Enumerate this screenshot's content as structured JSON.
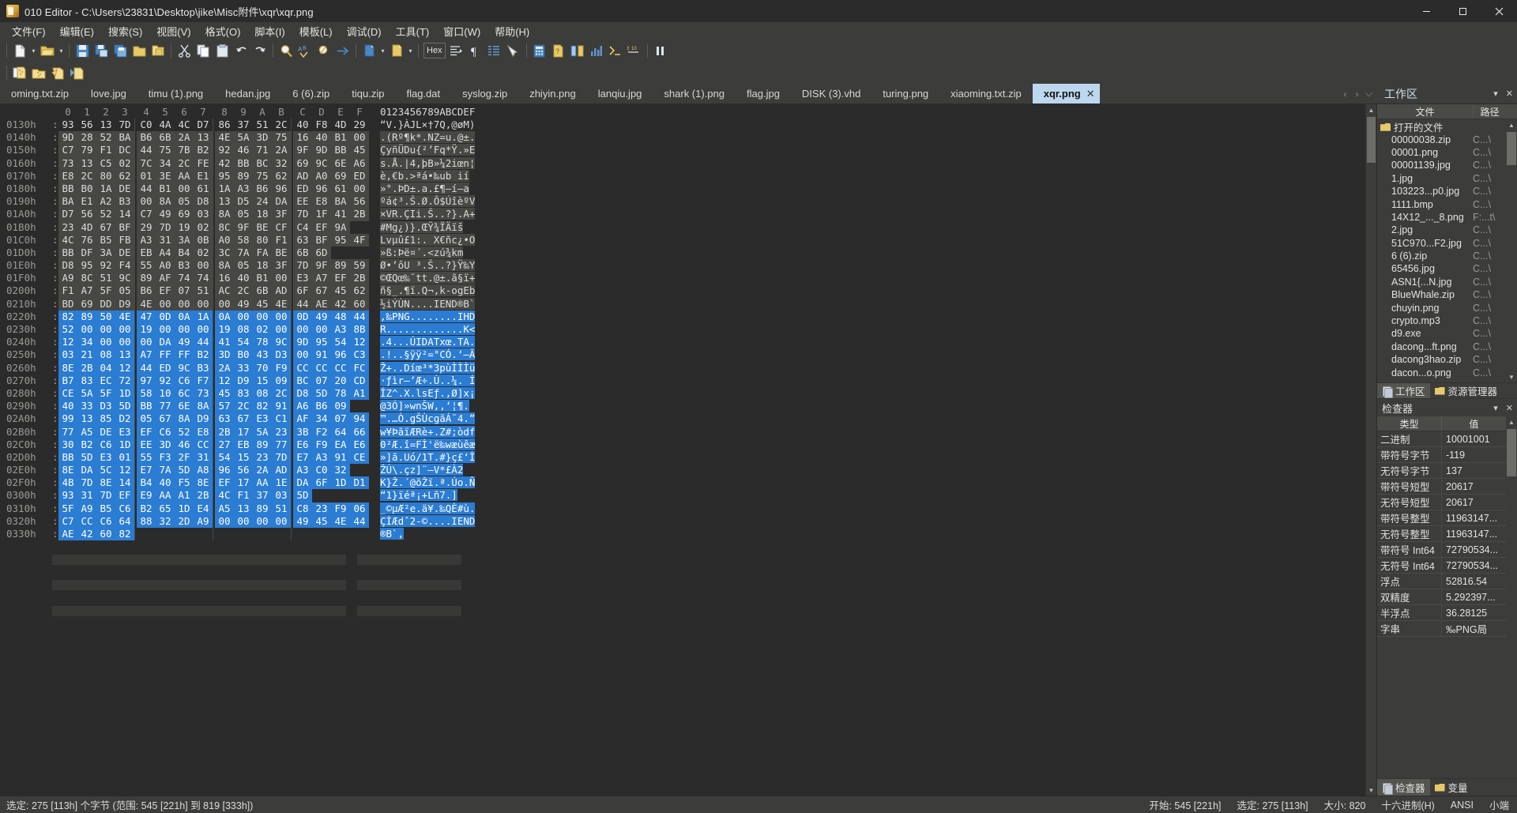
{
  "window": {
    "title": "010 Editor - C:\\Users\\23831\\Desktop\\jike\\Misc附件\\xqr\\xqr.png",
    "app_icon": "010-editor-icon",
    "minimize": "─",
    "maximize": "❐",
    "close": "✕"
  },
  "menu": [
    {
      "label": "文件(F)",
      "name": "menu-file"
    },
    {
      "label": "编辑(E)",
      "name": "menu-edit"
    },
    {
      "label": "搜索(S)",
      "name": "menu-search"
    },
    {
      "label": "视图(V)",
      "name": "menu-view"
    },
    {
      "label": "格式(O)",
      "name": "menu-format"
    },
    {
      "label": "脚本(I)",
      "name": "menu-script"
    },
    {
      "label": "模板(L)",
      "name": "menu-template"
    },
    {
      "label": "调试(D)",
      "name": "menu-debug"
    },
    {
      "label": "工具(T)",
      "name": "menu-tools"
    },
    {
      "label": "窗口(W)",
      "name": "menu-window"
    },
    {
      "label": "帮助(H)",
      "name": "menu-help"
    }
  ],
  "toolbar": {
    "hex_label": "Hex",
    "icons": [
      "new-file-icon",
      "open-folder-icon",
      "save-icon",
      "save-as-icon",
      "save-all-icon",
      "open-file-icon",
      "import-icon",
      "cut-icon",
      "copy-icon",
      "paste-icon",
      "undo-icon",
      "redo-icon",
      "find-icon",
      "replace-icon",
      "find-next-icon",
      "goto-icon",
      "import-hex-icon",
      "export-hex-icon",
      "hex-mode-icon",
      "line-format-icon",
      "paragraph-icon",
      "column-mode-icon",
      "highlight-icon",
      "calculator-icon",
      "checksum-icon",
      "compare-icon",
      "histogram-icon",
      "script-run-icon",
      "template-run-icon",
      "pause-icon"
    ],
    "row2_icons": [
      "new-script-icon",
      "open-script-icon",
      "run-script-icon",
      "run-template-icon"
    ]
  },
  "tabs": {
    "items": [
      {
        "label": "oming.txt.zip",
        "active": false
      },
      {
        "label": "love.jpg",
        "active": false
      },
      {
        "label": "timu (1).png",
        "active": false
      },
      {
        "label": "hedan.jpg",
        "active": false
      },
      {
        "label": "6 (6).zip",
        "active": false
      },
      {
        "label": "tiqu.zip",
        "active": false
      },
      {
        "label": "flag.dat",
        "active": false
      },
      {
        "label": "syslog.zip",
        "active": false
      },
      {
        "label": "zhiyin.png",
        "active": false
      },
      {
        "label": "lanqiu.jpg",
        "active": false
      },
      {
        "label": "shark (1).png",
        "active": false
      },
      {
        "label": "flag.jpg",
        "active": false
      },
      {
        "label": "DISK (3).vhd",
        "active": false
      },
      {
        "label": "turing.png",
        "active": false
      },
      {
        "label": "xiaoming.txt.zip",
        "active": false
      },
      {
        "label": "xqr.png",
        "active": true,
        "close": "✕"
      }
    ],
    "nav_prev": "‹",
    "nav_next": "›",
    "nav_list": "⌵"
  },
  "workspace_panel": {
    "title": "工作区",
    "menu_caret": "▾",
    "close": "✕",
    "columns": {
      "file": "文件",
      "path": "路径"
    },
    "root": "打开的文件",
    "files": [
      {
        "name": "00000038.zip",
        "path": "C...\\"
      },
      {
        "name": "00001.png",
        "path": "C...\\"
      },
      {
        "name": "00001139.jpg",
        "path": "C...\\"
      },
      {
        "name": "1.jpg",
        "path": "C...\\"
      },
      {
        "name": "103223...p0.jpg",
        "path": "C...\\"
      },
      {
        "name": "1111.bmp",
        "path": "C...\\"
      },
      {
        "name": "14X12_..._8.png",
        "path": "F:...t\\"
      },
      {
        "name": "2.jpg",
        "path": "C...\\"
      },
      {
        "name": "51C970...F2.jpg",
        "path": "C...\\"
      },
      {
        "name": "6 (6).zip",
        "path": "C...\\"
      },
      {
        "name": "65456.jpg",
        "path": "C...\\"
      },
      {
        "name": "ASN1{...N.jpg",
        "path": "C...\\"
      },
      {
        "name": "BlueWhale.zip",
        "path": "C...\\"
      },
      {
        "name": "chuyin.png",
        "path": "C...\\"
      },
      {
        "name": "crypto.mp3",
        "path": "C...\\"
      },
      {
        "name": "d9.exe",
        "path": "C...\\"
      },
      {
        "name": "dacong...ft.png",
        "path": "C...\\"
      },
      {
        "name": "dacong3hao.zip",
        "path": "C...\\"
      },
      {
        "name": "dacon...o.png",
        "path": "C...\\"
      }
    ],
    "panel_tabs": [
      {
        "label": "工作区",
        "icon": "workspace-icon",
        "active": true
      },
      {
        "label": "资源管理器",
        "icon": "explorer-folder-icon",
        "active": false
      }
    ]
  },
  "inspector": {
    "title": "检查器",
    "menu_caret": "▾",
    "close": "✕",
    "columns": {
      "type": "类型",
      "value": "值"
    },
    "rows": [
      {
        "type": "二进制",
        "value": "10001001"
      },
      {
        "type": "带符号字节",
        "value": "-119"
      },
      {
        "type": "无符号字节",
        "value": "137"
      },
      {
        "type": "带符号短型",
        "value": "20617"
      },
      {
        "type": "无符号短型",
        "value": "20617"
      },
      {
        "type": "带符号整型",
        "value": "11963147..."
      },
      {
        "type": "无符号整型",
        "value": "11963147..."
      },
      {
        "type": "带符号 Int64",
        "value": "72790534..."
      },
      {
        "type": "无符号 Int64",
        "value": "72790534..."
      },
      {
        "type": "浮点",
        "value": "52816.54"
      },
      {
        "type": "双精度",
        "value": "5.292397..."
      },
      {
        "type": "半浮点",
        "value": "36.28125"
      },
      {
        "type": "字串",
        "value": "‰PNG局"
      }
    ],
    "bottom_tabs": [
      {
        "label": "检查器",
        "icon": "inspector-icon",
        "active": true
      },
      {
        "label": "变量",
        "icon": "variables-icon",
        "active": false
      }
    ]
  },
  "hex": {
    "column_headers": [
      "0",
      "1",
      "2",
      "3",
      "4",
      "5",
      "6",
      "7",
      "8",
      "9",
      "A",
      "B",
      "C",
      "D",
      "E",
      "F"
    ],
    "ascii_header": "0123456789ABCDEF",
    "rows": [
      {
        "addr": "0130h",
        "bytes": [
          "93",
          "56",
          "13",
          "7D",
          "C0",
          "4A",
          "4C",
          "D7",
          "86",
          "37",
          "51",
          "2C",
          "40",
          "F8",
          "4D",
          "29"
        ],
        "ascii": "“V.}ÀJL×†7Q,@øM)",
        "sel": "none"
      },
      {
        "addr": "0140h",
        "bytes": [
          "9D",
          "28",
          "52",
          "BA",
          "B6",
          "6B",
          "2A",
          "13",
          "4E",
          "5A",
          "3D",
          "75",
          "16",
          "40",
          "B1",
          "00"
        ],
        "ascii": ".(Rº¶k*.NZ=u.@±.",
        "sel": "light"
      },
      {
        "addr": "0150h",
        "bytes": [
          "C7",
          "79",
          "F1",
          "DC",
          "44",
          "75",
          "7B",
          "B2",
          "92",
          "46",
          "71",
          "2A",
          "9F",
          "9D",
          "BB",
          "45"
        ],
        "ascii": "ÇyñÜDu{²’Fq*Ÿ.»E",
        "sel": "light"
      },
      {
        "addr": "0160h",
        "bytes": [
          "73",
          "13",
          "C5",
          "02",
          "7C",
          "34",
          "2C",
          "FE",
          "42",
          "BB",
          "BC",
          "32",
          "69",
          "9C",
          "6E",
          "A6"
        ],
        "ascii": "s.Å.|4,þB»¼2iœn¦",
        "sel": "light"
      },
      {
        "addr": "0170h",
        "bytes": [
          "E8",
          "2C",
          "80",
          "62",
          "01",
          "3E",
          "AA",
          "E1",
          "95",
          "89",
          "75",
          "62",
          "AD",
          "A0",
          "69",
          "ED"
        ],
        "ascii": "è,€b.>ªá•‰ub­ ií",
        "sel": "light"
      },
      {
        "addr": "0180h",
        "bytes": [
          "BB",
          "B0",
          "1A",
          "DE",
          "44",
          "B1",
          "00",
          "61",
          "1A",
          "A3",
          "B6",
          "96",
          "ED",
          "96",
          "61",
          "00"
        ],
        "ascii": "»°.ÞD±.a.£¶–í–a",
        "sel": "light"
      },
      {
        "addr": "0190h",
        "bytes": [
          "BA",
          "E1",
          "A2",
          "B3",
          "00",
          "8A",
          "05",
          "D8",
          "13",
          "D5",
          "24",
          "DA",
          "EE",
          "E8",
          "BA",
          "56"
        ],
        "ascii": "ºá¢³.Š.Ø.Õ$ÚîèºV",
        "sel": "light"
      },
      {
        "addr": "01A0h",
        "bytes": [
          "D7",
          "56",
          "52",
          "14",
          "C7",
          "49",
          "69",
          "03",
          "8A",
          "05",
          "18",
          "3F",
          "7D",
          "1F",
          "41",
          "2B"
        ],
        "ascii": "×VR.ÇIi.Š..?}.A+",
        "sel": "light"
      },
      {
        "addr": "01B0h",
        "bytes": [
          "23",
          "4D",
          "67",
          "BF",
          "29",
          "7D",
          "19",
          "02",
          "8C",
          "9F",
          "BE",
          "CF",
          "C4",
          "EF",
          "9A",
          ""
        ],
        "ascii": "#Mg¿)}.ŒŸ¾ÏÄïš",
        "sel": "light"
      },
      {
        "addr": "01C0h",
        "bytes": [
          "4C",
          "76",
          "B5",
          "FB",
          "A3",
          "31",
          "3A",
          "0B",
          "A0",
          "58",
          "80",
          "F1",
          "63",
          "BF",
          "95",
          "4F"
        ],
        "ascii": "Lvµû£1:. X€ñc¿•O",
        "sel": "light"
      },
      {
        "addr": "01D0h",
        "bytes": [
          "BB",
          "DF",
          "3A",
          "DE",
          "EB",
          "A4",
          "B4",
          "02",
          "3C",
          "7A",
          "FA",
          "BE",
          "6B",
          "6D",
          ""
        ],
        "ascii": "»ß:Þë¤´.<zú¾km",
        "sel": "light"
      },
      {
        "addr": "01E0h",
        "bytes": [
          "D8",
          "95",
          "92",
          "F4",
          "55",
          "A0",
          "B3",
          "00",
          "8A",
          "05",
          "18",
          "3F",
          "7D",
          "9F",
          "89",
          "59"
        ],
        "ascii": "Ø•’ôU ³.Š..?}Ÿ‰Y",
        "sel": "light"
      },
      {
        "addr": "01F0h",
        "bytes": [
          "A9",
          "8C",
          "51",
          "9C",
          "89",
          "AF",
          "74",
          "74",
          "16",
          "40",
          "B1",
          "00",
          "E3",
          "A7",
          "EF",
          "2B"
        ],
        "ascii": "©ŒQœ‰¯tt.@±.ã§ï+",
        "sel": "light"
      },
      {
        "addr": "0200h",
        "bytes": [
          "F1",
          "A7",
          "5F",
          "05",
          "B6",
          "EF",
          "07",
          "51",
          "AC",
          "2C",
          "6B",
          "AD",
          "6F",
          "67",
          "45",
          "62"
        ],
        "ascii": "ñ§_.¶ï.Q¬,k-ogEb",
        "sel": "light"
      },
      {
        "addr": "0210h",
        "bytes": [
          "BD",
          "69",
          "DD",
          "D9",
          "4E",
          "00",
          "00",
          "00",
          "00",
          "49",
          "45",
          "4E",
          "44",
          "AE",
          "42",
          "60"
        ],
        "ascii": "½iÝÙN....IEND®B`",
        "sel": "light"
      },
      {
        "addr": "0220h",
        "bytes": [
          "82",
          "89",
          "50",
          "4E",
          "47",
          "0D",
          "0A",
          "1A",
          "0A",
          "00",
          "00",
          "00",
          "0D",
          "49",
          "48",
          "44"
        ],
        "ascii": ",‰PNG........IHD",
        "sel": "blue"
      },
      {
        "addr": "0230h",
        "bytes": [
          "52",
          "00",
          "00",
          "00",
          "19",
          "00",
          "00",
          "00",
          "19",
          "08",
          "02",
          "00",
          "00",
          "00",
          "A3",
          "8B"
        ],
        "ascii": "R.............K<",
        "sel": "blue"
      },
      {
        "addr": "0240h",
        "bytes": [
          "12",
          "34",
          "00",
          "00",
          "00",
          "DA",
          "49",
          "44",
          "41",
          "54",
          "78",
          "9C",
          "9D",
          "95",
          "54",
          "12"
        ],
        "ascii": ".4...ÚIDATxœ.TA.",
        "sel": "blue"
      },
      {
        "addr": "0250h",
        "bytes": [
          "03",
          "21",
          "08",
          "13",
          "A7",
          "FF",
          "FF",
          "B2",
          "3D",
          "B0",
          "43",
          "D3",
          "00",
          "91",
          "96",
          "C3"
        ],
        "ascii": ".!..§ÿÿ²=°CÓ.‘–Ã",
        "sel": "blue"
      },
      {
        "addr": "0260h",
        "bytes": [
          "8E",
          "2B",
          "04",
          "12",
          "44",
          "ED",
          "9C",
          "B3",
          "2A",
          "33",
          "70",
          "F9",
          "CC",
          "CC",
          "CC",
          "FC"
        ],
        "ascii": "Ž+..Díœ³*3pùÌÌÌü",
        "sel": "blue"
      },
      {
        "addr": "0270h",
        "bytes": [
          "B7",
          "83",
          "EC",
          "72",
          "97",
          "92",
          "C6",
          "F7",
          "12",
          "D9",
          "15",
          "09",
          "BC",
          "07",
          "20",
          "CD"
        ],
        "ascii": "·ƒìr—’Æ÷.Ù..¼. Í",
        "sel": "blue"
      },
      {
        "addr": "0280h",
        "bytes": [
          "CE",
          "5A",
          "5F",
          "1D",
          "58",
          "10",
          "6C",
          "73",
          "45",
          "83",
          "08",
          "2C",
          "D8",
          "5D",
          "78",
          "A1"
        ],
        "ascii": "ÎZ^.X.lsEƒ.,Ø]x¡",
        "sel": "blue"
      },
      {
        "addr": "0290h",
        "bytes": [
          "40",
          "33",
          "D3",
          "5D",
          "BB",
          "77",
          "6E",
          "8A",
          "57",
          "2C",
          "82",
          "91",
          "A6",
          "B6",
          "09",
          ""
        ],
        "ascii": "@3Ó]»wnŠW,‚‘¦¶.",
        "sel": "blue"
      },
      {
        "addr": "02A0h",
        "bytes": [
          "99",
          "13",
          "85",
          "D2",
          "05",
          "67",
          "8A",
          "D9",
          "63",
          "67",
          "E3",
          "C1",
          "AF",
          "34",
          "07",
          "94"
        ],
        "ascii": "™.…Ò.gŠÙcgãÁ¯4.”",
        "sel": "blue"
      },
      {
        "addr": "02B0h",
        "bytes": [
          "77",
          "A5",
          "DE",
          "E3",
          "EF",
          "C6",
          "52",
          "E8",
          "2B",
          "17",
          "5A",
          "23",
          "3B",
          "F2",
          "64",
          "66"
        ],
        "ascii": "w¥ÞãïÆRè+.Z#;òdf",
        "sel": "blue"
      },
      {
        "addr": "02C0h",
        "bytes": [
          "30",
          "B2",
          "C6",
          "1D",
          "EE",
          "3D",
          "46",
          "CC",
          "27",
          "EB",
          "89",
          "77",
          "E6",
          "F9",
          "EA",
          "E6"
        ],
        "ascii": "0²Æ.î=FÌ'ë‰wæùêæ",
        "sel": "blue"
      },
      {
        "addr": "02D0h",
        "bytes": [
          "BB",
          "5D",
          "E3",
          "01",
          "55",
          "F3",
          "2F",
          "31",
          "54",
          "15",
          "23",
          "7D",
          "E7",
          "A3",
          "91",
          "CE"
        ],
        "ascii": "»]ã.Uó/1T.#}ç£‘Î",
        "sel": "blue"
      },
      {
        "addr": "02E0h",
        "bytes": [
          "8E",
          "DA",
          "5C",
          "12",
          "E7",
          "7A",
          "5D",
          "A8",
          "96",
          "56",
          "2A",
          "AD",
          "A3",
          "C0",
          "32",
          ""
        ],
        "ascii": "ŽÚ\\.çz]¨–V*­£À2",
        "sel": "blue"
      },
      {
        "addr": "02F0h",
        "bytes": [
          "4B",
          "7D",
          "8E",
          "14",
          "B4",
          "40",
          "F5",
          "8E",
          "EF",
          "17",
          "AA",
          "1E",
          "DA",
          "6F",
          "1D",
          "D1"
        ],
        "ascii": "K}Ž.´@õŽï.ª.Úo.Ñ",
        "sel": "blue"
      },
      {
        "addr": "0300h",
        "bytes": [
          "93",
          "31",
          "7D",
          "EF",
          "E9",
          "AA",
          "A1",
          "2B",
          "4C",
          "F1",
          "37",
          "03",
          "5D",
          ""
        ],
        "ascii": "“1}ïéª¡+Lñ7.]",
        "sel": "blue"
      },
      {
        "addr": "0310h",
        "bytes": [
          "5F",
          "A9",
          "B5",
          "C6",
          "B2",
          "65",
          "1D",
          "E4",
          "A5",
          "13",
          "89",
          "51",
          "C8",
          "23",
          "F9",
          "06"
        ],
        "ascii": "_©µÆ²e.ä¥.‰QÈ#ù.",
        "sel": "blue"
      },
      {
        "addr": "0320h",
        "bytes": [
          "C7",
          "CC",
          "C6",
          "64",
          "88",
          "32",
          "2D",
          "A9",
          "00",
          "00",
          "00",
          "00",
          "49",
          "45",
          "4E",
          "44"
        ],
        "ascii": "ÇÌÆdˆ2-©....IEND",
        "sel": "blue"
      },
      {
        "addr": "0330h",
        "bytes": [
          "AE",
          "42",
          "60",
          "82"
        ],
        "ascii": "®B`‚",
        "sel": "blue"
      }
    ]
  },
  "statusbar": {
    "left": "选定: 275 [113h] 个字节 (范围: 545 [221h] 到 819 [333h])",
    "start": "开始: 545 [221h]",
    "selected": "选定: 275 [113h]",
    "size": "大小: 820",
    "base": "十六进制(H)",
    "encoding": "ANSI",
    "endian": "小端"
  }
}
